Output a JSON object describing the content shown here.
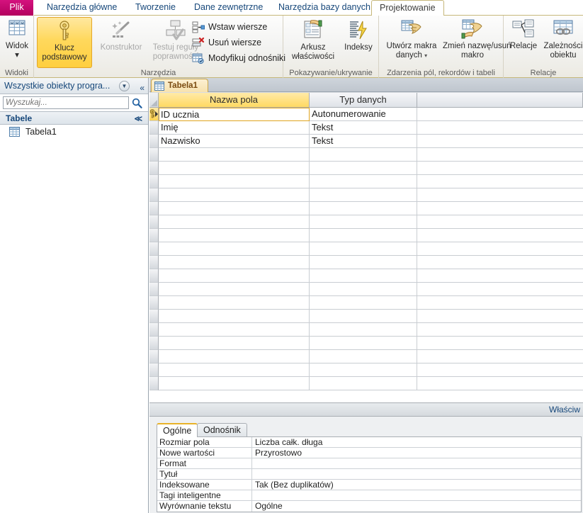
{
  "ribbon": {
    "tabs": [
      {
        "label": "Plik",
        "type": "file"
      },
      {
        "label": "Narzędzia główne",
        "type": "normal"
      },
      {
        "label": "Tworzenie",
        "type": "normal"
      },
      {
        "label": "Dane zewnętrzne",
        "type": "normal"
      },
      {
        "label": "Narzędzia bazy danych",
        "type": "normal"
      },
      {
        "label": "Projektowanie",
        "type": "active"
      }
    ],
    "groups": [
      {
        "label": "Widoki"
      },
      {
        "label": "Narzędzia"
      },
      {
        "label": "Pokazywanie/ukrywanie"
      },
      {
        "label": "Zdarzenia pól, rekordów i tabeli"
      },
      {
        "label": "Relacje"
      }
    ],
    "buttons": {
      "widok": {
        "label1": "Widok",
        "caret": "▾",
        "icon": "table-view-icon"
      },
      "klucz": {
        "label1": "Klucz",
        "label2": "podstawowy",
        "icon": "primary-key-icon",
        "selected": true
      },
      "konstruktor": {
        "label1": "Konstruktor",
        "icon": "builder-wand-icon",
        "disabled": true
      },
      "testuj": {
        "label1": "Testuj reguły",
        "label2": "poprawności",
        "icon": "validation-rules-icon",
        "disabled": true
      },
      "wstaw_wiersze": {
        "label": "Wstaw wiersze",
        "icon": "insert-rows-icon"
      },
      "usun_wiersze": {
        "label": "Usuń wiersze",
        "icon": "delete-rows-icon"
      },
      "modyfikuj_odnosniki": {
        "label": "Modyfikuj odnośniki",
        "icon": "modify-lookups-icon"
      },
      "arkusz": {
        "label1": "Arkusz",
        "label2": "właściwości",
        "icon": "property-sheet-icon"
      },
      "indeksy": {
        "label1": "Indeksy",
        "icon": "indexes-icon"
      },
      "utworz_makra": {
        "label1": "Utwórz makra",
        "label2": "danych",
        "caret": "▾",
        "icon": "create-data-macros-icon"
      },
      "zmien_nazwe": {
        "label1": "Zmień nazwę/usuń",
        "label2": "makro",
        "icon": "rename-delete-macro-icon"
      },
      "relacje": {
        "label1": "Relacje",
        "icon": "relationships-icon"
      },
      "zaleznosci": {
        "label1": "Zależności",
        "label2": "obiektu",
        "icon": "object-dependencies-icon"
      }
    }
  },
  "navpane": {
    "title": "Wszystkie obiekty progra...",
    "dropdown_icon": "chevron-down-circle-icon",
    "collapse_icon": "double-chevron-left-icon",
    "search": {
      "value": "",
      "placeholder": "Wyszukaj...",
      "icon": "search-icon"
    },
    "groups": [
      {
        "label": "Tabele",
        "collapse_icon": "double-chevron-up-icon",
        "items": [
          {
            "label": "Tabela1",
            "icon": "table-icon"
          }
        ]
      }
    ]
  },
  "workarea": {
    "document_tab": {
      "label": "Tabela1",
      "icon": "table-icon"
    },
    "grid": {
      "headers": [
        "Nazwa pola",
        "Typ danych",
        ""
      ],
      "rows": [
        {
          "field_name": "ID ucznia",
          "data_type": "Autonumerowanie",
          "description": "",
          "primary_key": true,
          "current": true
        },
        {
          "field_name": "Imię",
          "data_type": "Tekst",
          "description": "",
          "primary_key": false,
          "current": false
        },
        {
          "field_name": "Nazwisko",
          "data_type": "Tekst",
          "description": "",
          "primary_key": false,
          "current": false
        }
      ],
      "empty_row_count": 18
    },
    "properties_bar_label": "Właściw",
    "properties": {
      "tabs": [
        {
          "label": "Ogólne",
          "active": true
        },
        {
          "label": "Odnośnik",
          "active": false
        }
      ],
      "rows": [
        {
          "name": "Rozmiar pola",
          "value": "Liczba całk. długa"
        },
        {
          "name": "Nowe wartości",
          "value": "Przyrostowo"
        },
        {
          "name": "Format",
          "value": ""
        },
        {
          "name": "Tytuł",
          "value": ""
        },
        {
          "name": "Indeksowane",
          "value": "Tak (Bez duplikatów)"
        },
        {
          "name": "Tagi inteligentne",
          "value": ""
        },
        {
          "name": "Wyrównanie tekstu",
          "value": "Ogólne"
        }
      ]
    }
  },
  "colors": {
    "file_tab": "#c4006b",
    "tab_text": "#16477a",
    "ribbon_border": "#c6b77a",
    "selected_button": "#ffd85c",
    "header_field_name": "#ffd961",
    "doctab": "#f7e2ae"
  }
}
